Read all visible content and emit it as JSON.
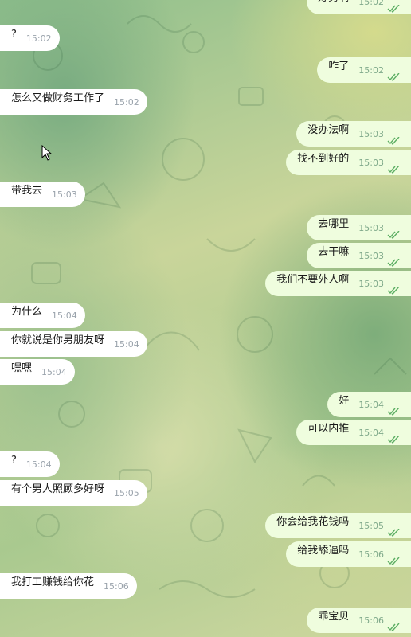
{
  "colors": {
    "incoming_bubble": "#ffffff",
    "outgoing_bubble": "#effdde",
    "timestamp_in": "#9aa3ac",
    "timestamp_out": "#7fa98a",
    "read_ticks": "#5cae63"
  },
  "messages": [
    {
      "dir": "out",
      "text": "好男啊",
      "time": "15:02"
    },
    {
      "dir": "in",
      "text": "?",
      "time": "15:02"
    },
    {
      "dir": "out",
      "text": "咋了",
      "time": "15:02"
    },
    {
      "dir": "in",
      "text": "怎么又做财务工作了",
      "time": "15:02"
    },
    {
      "dir": "out",
      "text": "没办法啊",
      "time": "15:03"
    },
    {
      "dir": "out",
      "text": "找不到好的",
      "time": "15:03"
    },
    {
      "dir": "in",
      "text": "带我去",
      "time": "15:03"
    },
    {
      "dir": "out",
      "text": "去哪里",
      "time": "15:03"
    },
    {
      "dir": "out",
      "text": "去干嘛",
      "time": "15:03"
    },
    {
      "dir": "out",
      "text": "我们不要外人啊",
      "time": "15:03"
    },
    {
      "dir": "in",
      "text": "为什么",
      "time": "15:04"
    },
    {
      "dir": "in",
      "text": "你就说是你男朋友呀",
      "time": "15:04"
    },
    {
      "dir": "in",
      "text": "嘿嘿",
      "time": "15:04"
    },
    {
      "dir": "out",
      "text": "好",
      "time": "15:04"
    },
    {
      "dir": "out",
      "text": "可以内推",
      "time": "15:04"
    },
    {
      "dir": "in",
      "text": "?",
      "time": "15:04"
    },
    {
      "dir": "in",
      "text": "有个男人照顾多好呀",
      "time": "15:05"
    },
    {
      "dir": "out",
      "text": "你会给我花钱吗",
      "time": "15:05"
    },
    {
      "dir": "out",
      "text": "给我舔逼吗",
      "time": "15:06"
    },
    {
      "dir": "in",
      "text": "我打工赚钱给你花",
      "time": "15:06"
    },
    {
      "dir": "out",
      "text": "乖宝贝",
      "time": "15:06"
    }
  ]
}
